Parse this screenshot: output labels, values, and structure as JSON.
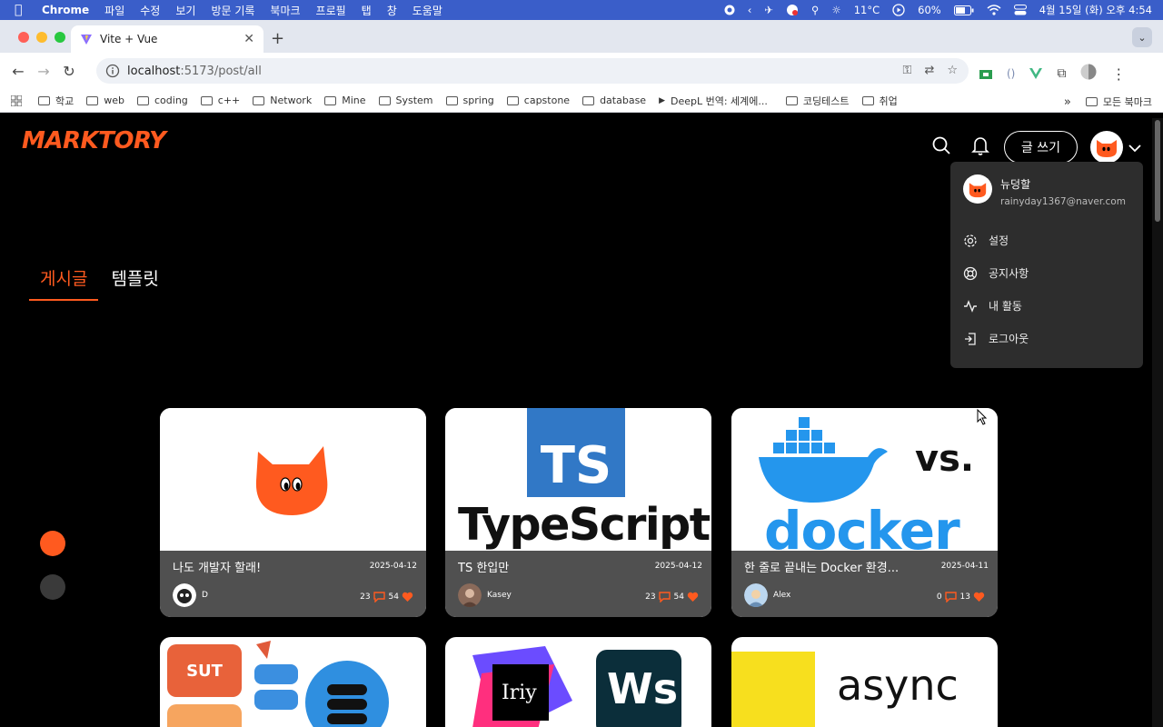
{
  "mac_menubar": {
    "app": "Chrome",
    "menus": [
      "파일",
      "수정",
      "보기",
      "방문 기록",
      "북마크",
      "프로필",
      "탭",
      "창",
      "도움말"
    ],
    "temperature": "11°C",
    "battery": "60%",
    "datetime": "4월 15일 (화) 오후 4:54"
  },
  "browser": {
    "tab_title": "Vite + Vue",
    "url_host": "localhost",
    "url_path": ":5173/post/all",
    "bookmarks": [
      "학교",
      "web",
      "coding",
      "c++",
      "Network",
      "Mine",
      "System",
      "spring",
      "capstone",
      "database",
      "DeepL 번역: 세계에...",
      "코딩테스트",
      "취업"
    ],
    "bookmarks_right": "모든 북마크"
  },
  "site": {
    "logo": "MARKTORY",
    "write_button": "글 쓰기"
  },
  "user_menu": {
    "name": "뉴덩할",
    "email": "rainyday1367@naver.com",
    "items": [
      "설정",
      "공지사항",
      "내 활동",
      "로그아웃"
    ]
  },
  "page_tabs": {
    "posts": "게시글",
    "templates": "템플릿"
  },
  "posts": [
    {
      "title": "나도 개발자 할래!",
      "date": "2025-04-12",
      "author": "D",
      "comments": "23",
      "likes": "54"
    },
    {
      "title": "TS 한입만",
      "date": "2025-04-12",
      "author": "Kasey",
      "comments": "23",
      "likes": "54",
      "thumb_text": "TypeScript",
      "thumb_badge": "TS"
    },
    {
      "title": "한 줄로 끝내는 Docker 환경...",
      "date": "2025-04-11",
      "author": "Alex",
      "comments": "0",
      "likes": "13",
      "thumb_text": "docker",
      "thumb_vs": "vs."
    }
  ],
  "row2_thumbs": {
    "card1_label": "SUT",
    "card2_label": "Ws",
    "card3_label": "async"
  },
  "colors": {
    "accent": "#ff5a1f",
    "card_info_bg": "#505050",
    "dropdown_bg": "#2d2d2d"
  }
}
